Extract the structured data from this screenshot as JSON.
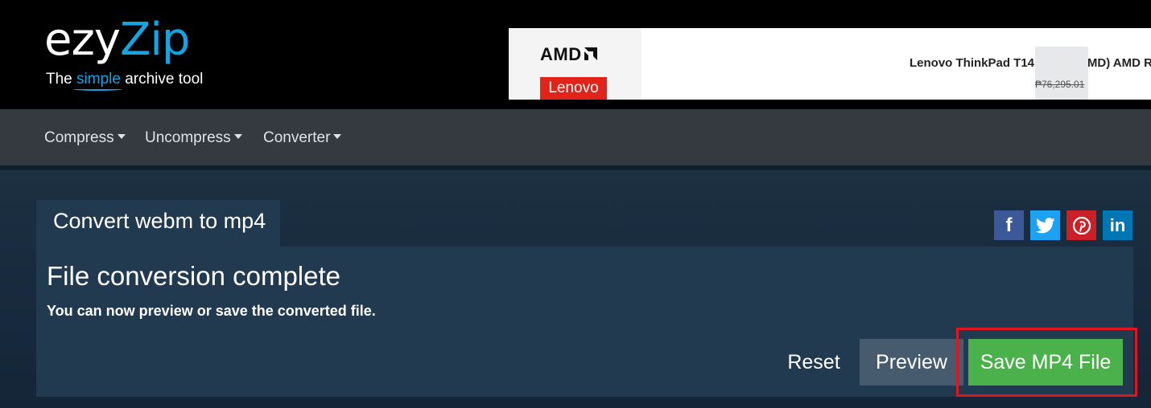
{
  "logo": {
    "main_a": "ezy",
    "main_b": "Zip",
    "tagline_pre": "The ",
    "tagline_simple": "simple",
    "tagline_post": " archive tool"
  },
  "ad": {
    "brand_amd": "AMD",
    "brand_lenovo": "Lenovo",
    "product": "Lenovo ThinkPad T14 Gen 4 (AMD) AMD R",
    "price": "₱76,295.01"
  },
  "nav": {
    "items": [
      {
        "label": "Compress"
      },
      {
        "label": "Uncompress"
      },
      {
        "label": "Converter"
      }
    ]
  },
  "tab": {
    "label": "Convert webm to mp4"
  },
  "social": {
    "facebook_glyph": "f",
    "linkedin_glyph": "in"
  },
  "panel": {
    "title": "File conversion complete",
    "subtitle": "You can now preview or save the converted file."
  },
  "actions": {
    "reset_label": "Reset",
    "preview_label": "Preview",
    "save_label": "Save MP4 File"
  },
  "colors": {
    "accent": "#17a2e0",
    "save": "#4bb14a",
    "highlight": "#e0151f"
  }
}
